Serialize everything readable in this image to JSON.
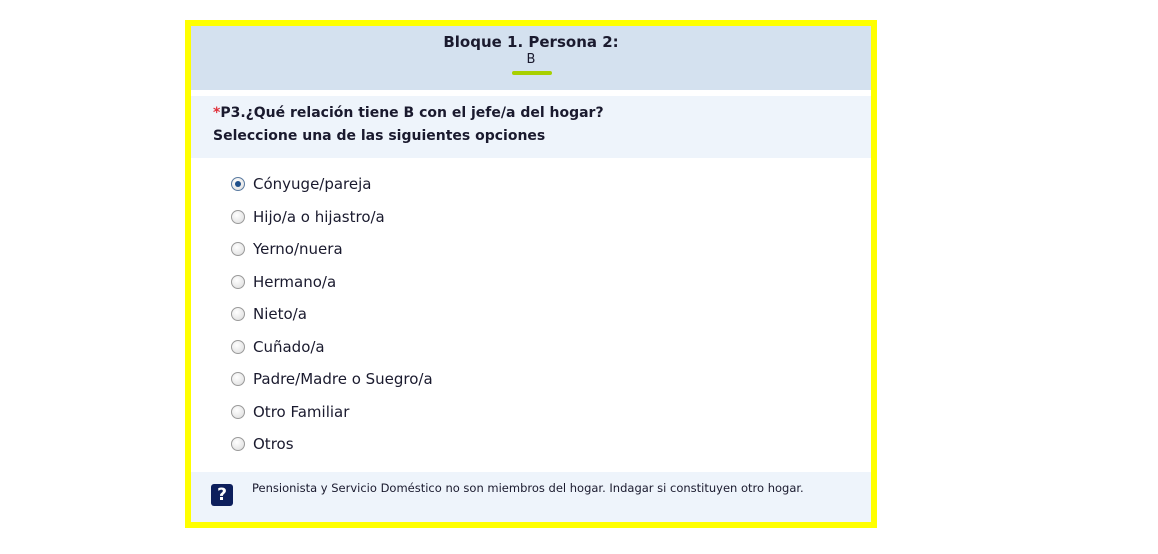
{
  "header": {
    "title": "Bloque 1. Persona 2:",
    "person_name": "B"
  },
  "question": {
    "required_mark": "*",
    "line1": "P3.¿Qué relación tiene B con el jefe/a del hogar?",
    "line2": "Seleccione una de las siguientes opciones"
  },
  "options": [
    {
      "label": "Cónyuge/pareja",
      "selected": true
    },
    {
      "label": "Hijo/a o hijastro/a",
      "selected": false
    },
    {
      "label": "Yerno/nuera",
      "selected": false
    },
    {
      "label": "Hermano/a",
      "selected": false
    },
    {
      "label": "Nieto/a",
      "selected": false
    },
    {
      "label": "Cuñado/a",
      "selected": false
    },
    {
      "label": "Padre/Madre o Suegro/a",
      "selected": false
    },
    {
      "label": "Otro Familiar",
      "selected": false
    },
    {
      "label": "Otros",
      "selected": false
    }
  ],
  "help": {
    "icon": "question-mark-icon",
    "icon_glyph": "?",
    "text": "Pensionista  y Servicio Doméstico no son miembros del hogar. Indagar si constituyen otro hogar."
  },
  "colors": {
    "frame_border": "#ffff00",
    "header_bg": "#d4e1ef",
    "underline_accent": "#a8d000",
    "required_red": "#e0303a",
    "help_icon_bg": "#0d1f5c"
  }
}
